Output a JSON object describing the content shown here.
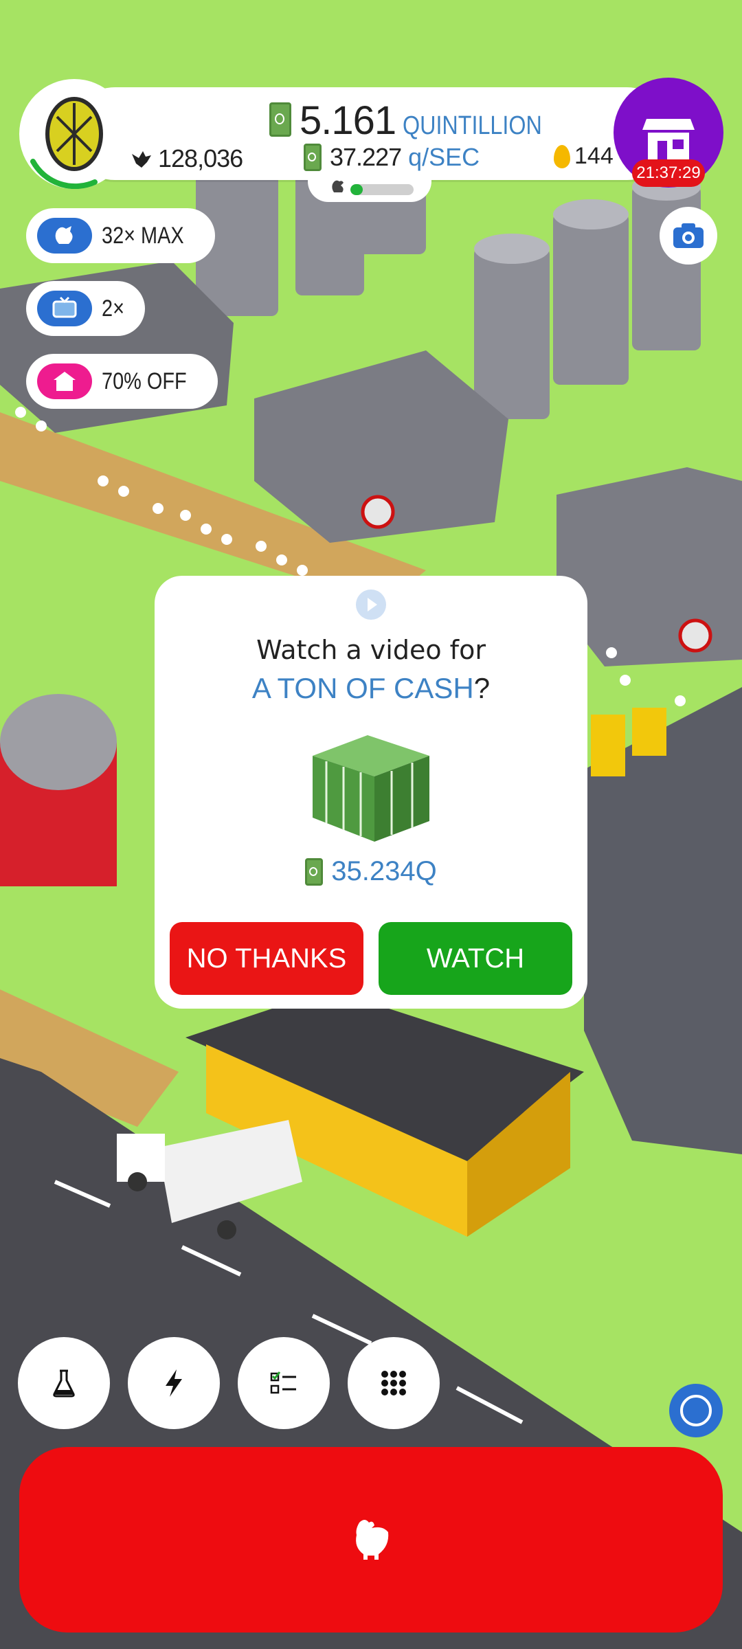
{
  "hud": {
    "cash_value": "5.161",
    "cash_unit": "QUINTILLION",
    "chickens": "128,036",
    "rate_value": "37.227",
    "rate_unit": "q/SEC",
    "golden_eggs": "144",
    "shop_timer": "21:37:29",
    "habitat_progress": 0.2
  },
  "boosts": [
    {
      "label": "32× MAX",
      "icon": "chicken-icon",
      "color": "#2b6fd0"
    },
    {
      "label": "2×",
      "icon": "tv-icon",
      "color": "#2b6fd0"
    },
    {
      "label": "70% OFF",
      "icon": "house-icon",
      "color": "#ee1c8f"
    }
  ],
  "popup": {
    "line1": "Watch a video for",
    "highlight": "A TON OF CASH",
    "question_mark": "?",
    "reward": "35.234Q",
    "no_label": "NO THANKS",
    "watch_label": "WATCH"
  },
  "toolbar": {
    "items": [
      "flask-icon",
      "lightning-icon",
      "checklist-icon",
      "grid-icon"
    ]
  },
  "colors": {
    "grass": "#a6e363",
    "accent_blue": "#3d82c4",
    "shop_purple": "#7e0fc9",
    "hatch_red": "#ee0c10",
    "watch_green": "#17a51b",
    "no_red": "#ea1515"
  }
}
